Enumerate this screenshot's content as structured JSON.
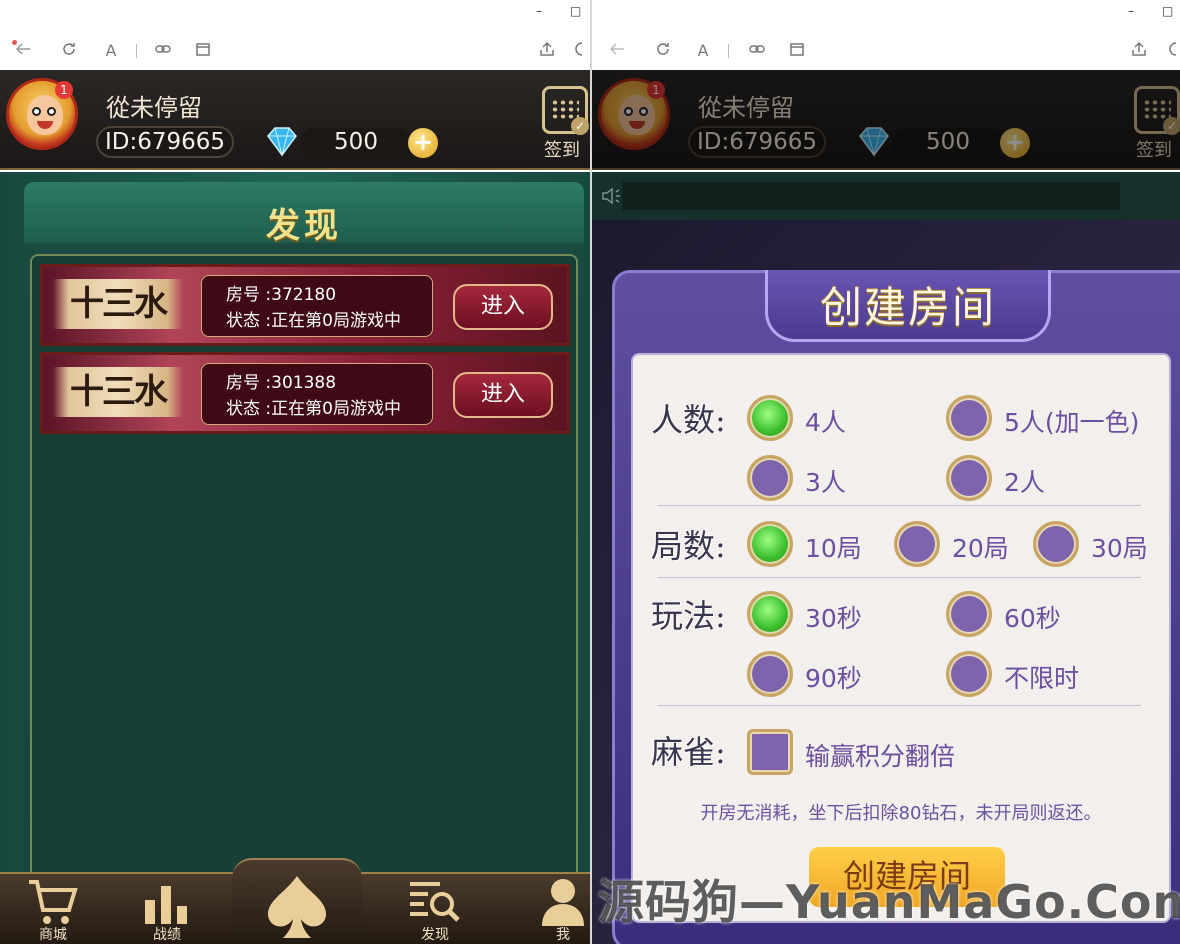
{
  "window": {
    "minimize": "–",
    "maximize": "□"
  },
  "icons": {
    "back": "back-arrow-icon",
    "refresh": "refresh-icon",
    "font": "font-icon",
    "link": "link-icon",
    "window": "window-icon",
    "share": "share-icon"
  },
  "toolbar": {
    "font_label": "A"
  },
  "user": {
    "name": "從未停留",
    "id": "ID:679665",
    "diamonds": "500",
    "badge": "1"
  },
  "header": {
    "signin_label": "签到"
  },
  "discover": {
    "title": "发现",
    "rooms": [
      {
        "game": "十三水",
        "room_no": "房号 :372180",
        "status": "状态 :正在第0局游戏中",
        "enter": "进入"
      },
      {
        "game": "十三水",
        "room_no": "房号 :301388",
        "status": "状态 :正在第0局游戏中",
        "enter": "进入"
      }
    ]
  },
  "nav": {
    "shop": "商城",
    "records": "战绩",
    "discover": "发现",
    "me": "我"
  },
  "create_room": {
    "title": "创建房间",
    "players_label": "人数:",
    "players_options": [
      "4人",
      "5人(加一色)",
      "3人",
      "2人"
    ],
    "players_selected": "4人",
    "rounds_label": "局数:",
    "rounds_options": [
      "10局",
      "20局",
      "30局"
    ],
    "rounds_selected": "10局",
    "play_label": "玩法:",
    "play_options": [
      "30秒",
      "60秒",
      "90秒",
      "不限时"
    ],
    "play_selected": "30秒",
    "mahjong_label": "麻雀:",
    "mahjong_option": "输赢积分翻倍",
    "note": "开房无消耗，坐下后扣除80钻石，未开局则返还。",
    "button": "创建房间"
  },
  "watermark": "源码狗—YuanMaGo.Com",
  "colors": {
    "selected": "#3cbf2c",
    "unselected": "#7e64ad",
    "accent_gold": "#c9a563"
  }
}
